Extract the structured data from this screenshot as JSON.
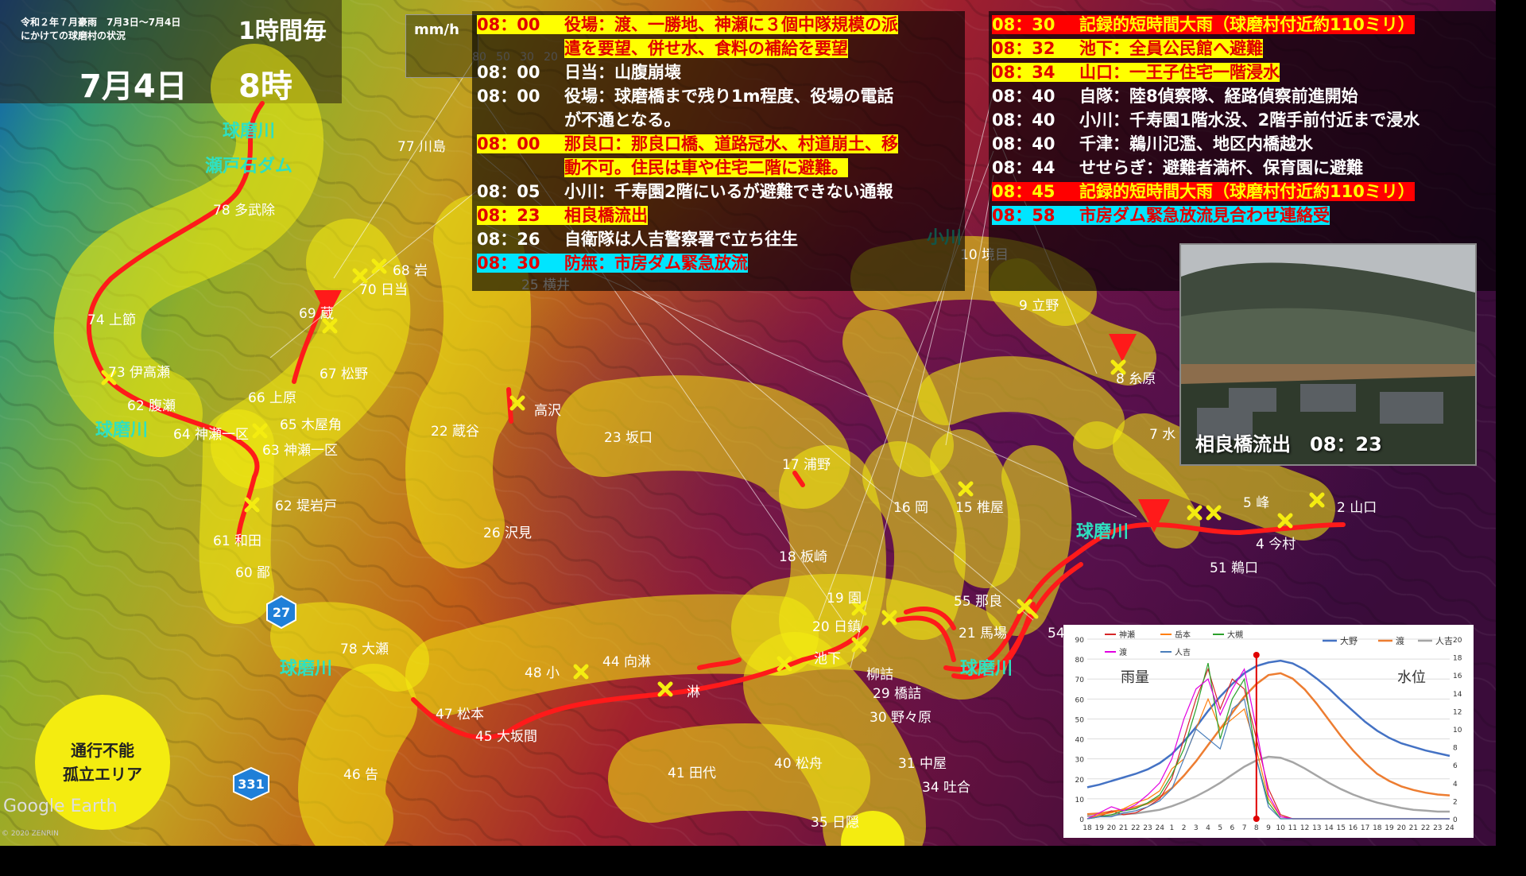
{
  "header": {
    "event_line1": "令和２年７月豪雨　7月3日〜7月4日",
    "event_line2": "にかけての球磨村の状況",
    "interval": "1時間毎",
    "date": "7月4日",
    "time": "8時"
  },
  "rain_scale": {
    "unit": "mm/h",
    "ticks": [
      "80",
      "50",
      "30",
      "20"
    ]
  },
  "log_left": [
    {
      "time": "08：00",
      "text": "役場：渡、一勝地、神瀬に３個中隊規模の派",
      "cont": "遣を要望、併せ水、食料の補給を要望",
      "style": "yellow"
    },
    {
      "time": "08：00",
      "text": "日当：山腹崩壊",
      "style": "none"
    },
    {
      "time": "08：00",
      "text": "役場：球磨橋まで残り1m程度、役場の電話",
      "cont": "が不通となる。",
      "style": "none"
    },
    {
      "time": "08：00",
      "text": "那良口：那良口橋、道路冠水、村道崩土、移",
      "cont": "動不可。住民は車や住宅二階に避難。",
      "style": "yellow"
    },
    {
      "time": "08：05",
      "text": "小川：千寿園2階にいるが避難できない通報",
      "style": "none"
    },
    {
      "time": "08：23",
      "text": "相良橋流出",
      "style": "yellow"
    },
    {
      "time": "08：26",
      "text": "自衛隊は人吉警察署で立ち往生",
      "style": "none"
    },
    {
      "time": "08：30",
      "text": "防無：市房ダム緊急放流",
      "style": "cyan"
    }
  ],
  "log_right": [
    {
      "time": "08：30",
      "text": "記録的短時間大雨（球磨村付近約110ミリ）",
      "style": "red"
    },
    {
      "time": "08：32",
      "text": "池下：全員公民館へ避難",
      "style": "yellow"
    },
    {
      "time": "08：34",
      "text": "山口：一王子住宅一階浸水",
      "style": "yellow"
    },
    {
      "time": "08：40",
      "text": "自隊：陸8偵察隊、経路偵察前進開始",
      "style": "none"
    },
    {
      "time": "08：40",
      "text": "小川：千寿園1階水没、2階手前付近まで浸水",
      "style": "none"
    },
    {
      "time": "08：40",
      "text": "千津：鵜川氾濫、地区内橋越水",
      "style": "none"
    },
    {
      "time": "08：44",
      "text": "せせらぎ：避難者満杯、保育園に避難",
      "style": "none"
    },
    {
      "time": "08：45",
      "text": "記録的短時間大雨（球磨村付近約110ミリ）",
      "style": "red"
    },
    {
      "time": "08：58",
      "text": "市房ダム緊急放流見合わせ連絡受",
      "style": "cyan"
    }
  ],
  "photo": {
    "caption": "相良橋流出　08：23"
  },
  "isolation_legend": {
    "line1": "通行不能",
    "line2": "孤立エリア"
  },
  "route_badges": [
    "27",
    "331"
  ],
  "map_labels": [
    {
      "text": "球磨川"
    },
    {
      "text": "瀬戸石ダム"
    },
    {
      "text": "77 川島"
    },
    {
      "text": "78 多武除"
    },
    {
      "text": "74 上節"
    },
    {
      "text": "73 伊高瀬"
    },
    {
      "text": "62 腹瀬"
    },
    {
      "text": "球磨川"
    },
    {
      "text": "64 神瀬一区"
    },
    {
      "text": "66 上原"
    },
    {
      "text": "65 木屋角"
    },
    {
      "text": "63 神瀬一区"
    },
    {
      "text": "62 堤岩戸"
    },
    {
      "text": "61 和田"
    },
    {
      "text": "60 鄙"
    },
    {
      "text": "69 蔵"
    },
    {
      "text": "67 松野"
    },
    {
      "text": "68 岩"
    },
    {
      "text": "70 日当"
    },
    {
      "text": "22 蔵谷"
    },
    {
      "text": "高沢"
    },
    {
      "text": "25 横井"
    },
    {
      "text": "26 沢見"
    },
    {
      "text": "23 坂口"
    },
    {
      "text": "小川"
    },
    {
      "text": "10 境目"
    },
    {
      "text": "9 立野"
    },
    {
      "text": "8 糸原"
    },
    {
      "text": "7 水"
    },
    {
      "text": "17 浦野"
    },
    {
      "text": "16 岡"
    },
    {
      "text": "15 椎屋"
    },
    {
      "text": "5 峰"
    },
    {
      "text": "2 山口"
    },
    {
      "text": "4 今村"
    },
    {
      "text": "51 鵜口"
    },
    {
      "text": "18 板崎"
    },
    {
      "text": "球磨川"
    },
    {
      "text": "19 園"
    },
    {
      "text": "20 日鎮"
    },
    {
      "text": "池下"
    },
    {
      "text": "柳詰"
    },
    {
      "text": "55 那良"
    },
    {
      "text": "21 馬場"
    },
    {
      "text": "球磨川"
    },
    {
      "text": "54"
    },
    {
      "text": "29 橋詰"
    },
    {
      "text": "30 野々原"
    },
    {
      "text": "31 中屋"
    },
    {
      "text": "34 吐合"
    },
    {
      "text": "35 日隠"
    },
    {
      "text": "40 松舟"
    },
    {
      "text": "41 田代"
    },
    {
      "text": "48 小"
    },
    {
      "text": "44 向淋"
    },
    {
      "text": "淋"
    },
    {
      "text": "47 松本"
    },
    {
      "text": "45 大坂間"
    },
    {
      "text": "46 告"
    },
    {
      "text": "78 大瀬"
    },
    {
      "text": "球磨川"
    }
  ],
  "attribution": {
    "logo": "Google Earth",
    "copyright": "© 2020 ZENRIN"
  },
  "chart_data": {
    "type": "line",
    "x": [
      "18",
      "19",
      "20",
      "21",
      "22",
      "23",
      "24",
      "1",
      "2",
      "3",
      "4",
      "5",
      "6",
      "7",
      "8",
      "9",
      "10",
      "11",
      "12",
      "13",
      "14",
      "15",
      "16",
      "17",
      "18",
      "19",
      "20",
      "21",
      "22",
      "23",
      "24"
    ],
    "left_axis": {
      "label": "雨量",
      "ylim": [
        0,
        90
      ],
      "ticks": [
        0,
        10,
        20,
        30,
        40,
        50,
        60,
        70,
        80,
        90
      ]
    },
    "right_axis": {
      "label": "水位",
      "ylim": [
        0,
        20
      ],
      "ticks": [
        0,
        2,
        4,
        6,
        8,
        10,
        12,
        14,
        16,
        18,
        20
      ]
    },
    "current_x": "8",
    "rain_series": [
      {
        "name": "神瀬",
        "color": "#d62728",
        "values": [
          0,
          1,
          4,
          2,
          3,
          6,
          10,
          20,
          40,
          60,
          75,
          55,
          70,
          65,
          40,
          15,
          2,
          0,
          0,
          0,
          0,
          0,
          0,
          0,
          0,
          0,
          0,
          0,
          0,
          0,
          0
        ]
      },
      {
        "name": "岳本",
        "color": "#ff7f0e",
        "values": [
          0,
          2,
          3,
          5,
          8,
          10,
          14,
          25,
          30,
          45,
          60,
          45,
          50,
          55,
          35,
          10,
          1,
          0,
          0,
          0,
          0,
          0,
          0,
          0,
          0,
          0,
          0,
          0,
          0,
          0,
          0
        ]
      },
      {
        "name": "大槻",
        "color": "#2ca02c",
        "values": [
          0,
          1,
          2,
          4,
          5,
          8,
          12,
          22,
          35,
          55,
          78,
          40,
          60,
          70,
          30,
          8,
          0,
          0,
          0,
          0,
          0,
          0,
          0,
          0,
          0,
          0,
          0,
          0,
          0,
          0,
          0
        ]
      },
      {
        "name": "渡",
        "color": "#e100e1",
        "values": [
          0,
          3,
          6,
          4,
          7,
          12,
          18,
          30,
          50,
          65,
          70,
          52,
          65,
          75,
          45,
          12,
          1,
          0,
          0,
          0,
          0,
          0,
          0,
          0,
          0,
          0,
          0,
          0,
          0,
          0,
          0
        ]
      },
      {
        "name": "人吉",
        "color": "#4a7ebb",
        "values": [
          0,
          1,
          1,
          3,
          4,
          6,
          9,
          15,
          30,
          45,
          40,
          35,
          55,
          60,
          30,
          6,
          0,
          0,
          0,
          0,
          0,
          0,
          0,
          0,
          0,
          0,
          0,
          0,
          0,
          0,
          0
        ]
      }
    ],
    "level_series": [
      {
        "name": "大野",
        "color": "#4472c4",
        "values": [
          3.5,
          3.8,
          4.2,
          4.6,
          5.0,
          5.5,
          6.2,
          7.2,
          8.6,
          10.2,
          12.0,
          13.6,
          15.0,
          16.2,
          17.0,
          17.4,
          17.6,
          17.3,
          16.6,
          15.6,
          14.5,
          13.2,
          12.0,
          10.8,
          9.8,
          9.0,
          8.4,
          8.0,
          7.6,
          7.3,
          7.0
        ]
      },
      {
        "name": "渡",
        "color": "#ed7d31",
        "values": [
          0.5,
          0.6,
          0.8,
          1.0,
          1.3,
          1.7,
          2.4,
          3.4,
          4.8,
          6.4,
          8.2,
          10.0,
          11.8,
          13.6,
          15.0,
          16.0,
          16.2,
          15.6,
          14.4,
          12.8,
          11.0,
          9.2,
          7.6,
          6.2,
          5.0,
          4.2,
          3.6,
          3.2,
          2.9,
          2.7,
          2.6
        ]
      },
      {
        "name": "人吉",
        "color": "#a5a5a5",
        "values": [
          0.3,
          0.3,
          0.4,
          0.5,
          0.6,
          0.8,
          1.0,
          1.4,
          1.9,
          2.5,
          3.2,
          4.0,
          4.9,
          5.8,
          6.5,
          6.9,
          6.8,
          6.3,
          5.6,
          4.8,
          4.0,
          3.3,
          2.7,
          2.2,
          1.8,
          1.5,
          1.2,
          1.0,
          0.9,
          0.8,
          0.8
        ]
      }
    ]
  }
}
